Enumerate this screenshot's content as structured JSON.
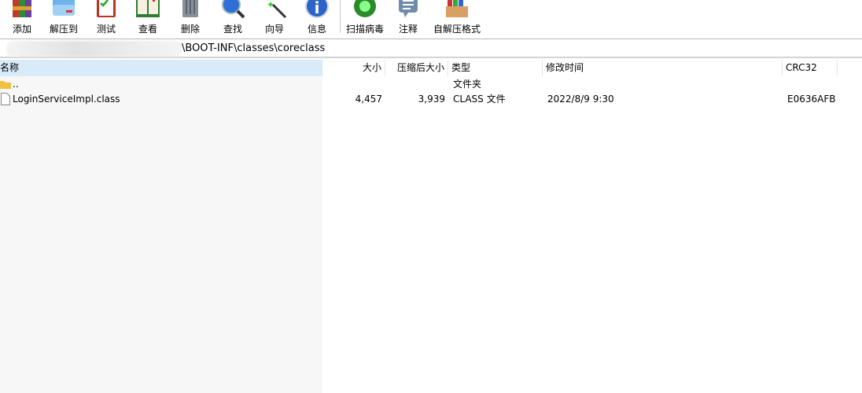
{
  "toolbar": {
    "items": [
      {
        "label": "添加",
        "icon": "archive-books-icon"
      },
      {
        "label": "解压到",
        "icon": "extract-folder-icon"
      },
      {
        "label": "测试",
        "icon": "test-checklist-icon"
      },
      {
        "label": "查看",
        "icon": "view-book-icon"
      },
      {
        "label": "删除",
        "icon": "trash-icon"
      },
      {
        "label": "查找",
        "icon": "magnifier-icon"
      },
      {
        "label": "向导",
        "icon": "wizard-wand-icon"
      },
      {
        "label": "信息",
        "icon": "info-icon"
      },
      {
        "label": "扫描病毒",
        "icon": "virus-scan-icon"
      },
      {
        "label": "注释",
        "icon": "comment-icon"
      },
      {
        "label": "自解压格式",
        "icon": "sfx-box-icon"
      }
    ]
  },
  "address": {
    "path": "\\BOOT-INF\\classes\\coreclass"
  },
  "columns": {
    "name": "名称",
    "size": "大小",
    "packed": "压缩后大小",
    "type": "类型",
    "modified": "修改时间",
    "crc": "CRC32"
  },
  "rows": [
    {
      "name": "..",
      "size": "",
      "packed": "",
      "type": "文件夹",
      "modified": "",
      "crc": "",
      "icon": "folder-icon"
    },
    {
      "name": "LoginServiceImpl.class",
      "size": "4,457",
      "packed": "3,939",
      "type": "CLASS 文件",
      "modified": "2022/8/9 9:30",
      "crc": "E0636AFB",
      "icon": "file-icon"
    }
  ]
}
